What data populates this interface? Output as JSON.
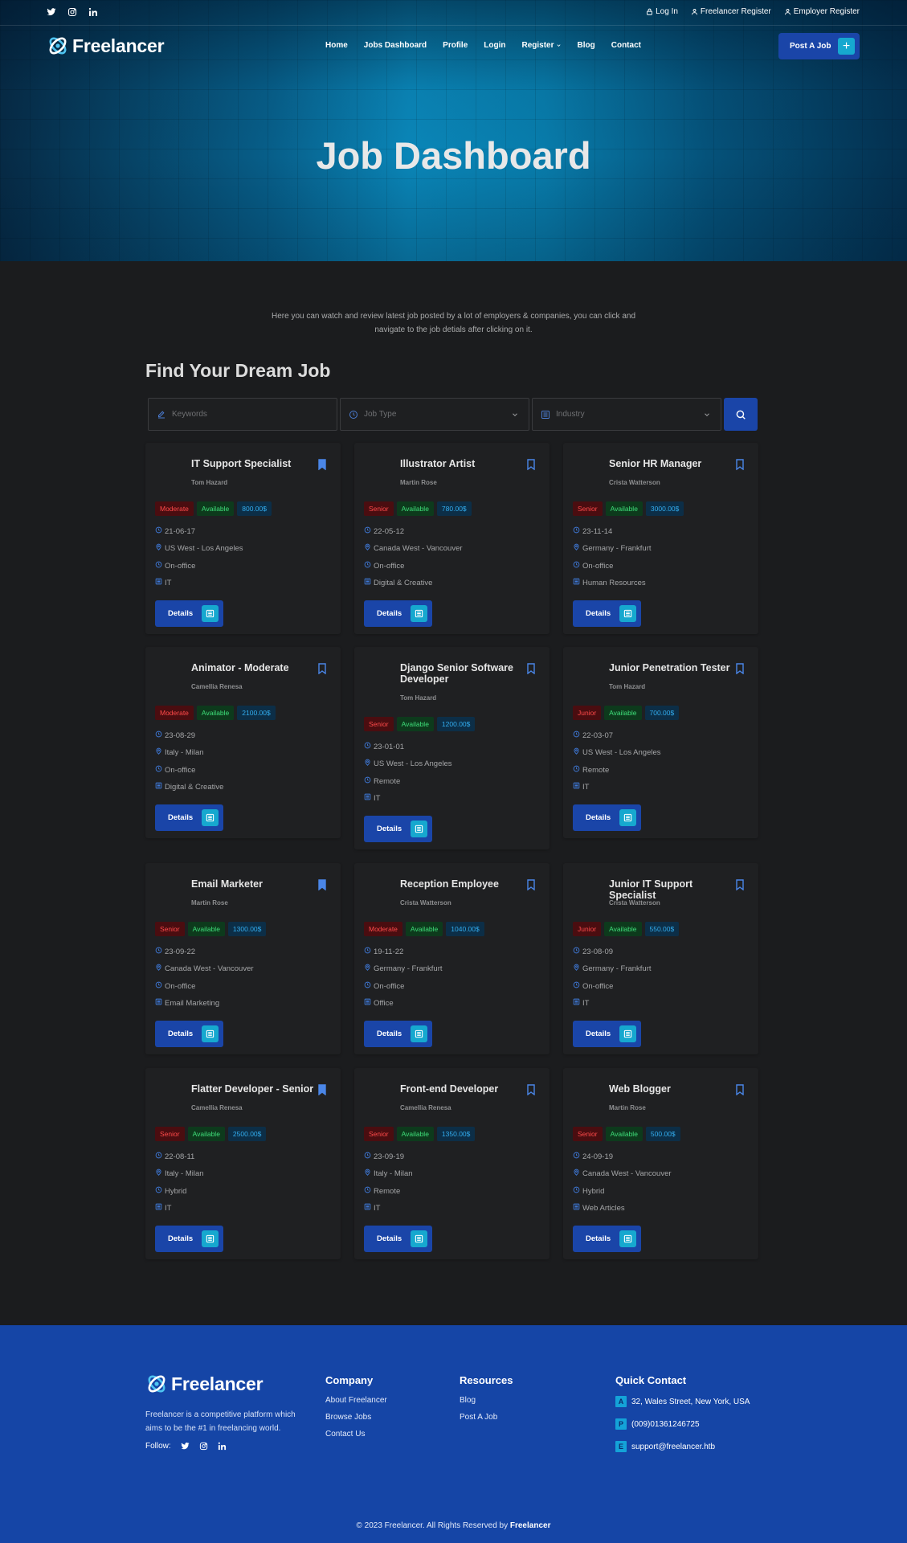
{
  "topbar": {
    "social": [
      "twitter-icon",
      "instagram-icon",
      "linkedin-icon"
    ],
    "links": [
      {
        "label": "Log In",
        "icon": "lock-icon"
      },
      {
        "label": "Freelancer Register",
        "icon": "user-icon"
      },
      {
        "label": "Employer Register",
        "icon": "user-icon"
      }
    ]
  },
  "header": {
    "logo": "Freelancer",
    "nav": [
      "Home",
      "Jobs Dashboard",
      "Profile",
      "Login",
      "Register",
      "Blog",
      "Contact"
    ],
    "post_job": "Post A Job"
  },
  "hero": {
    "title": "Job Dashboard"
  },
  "intro": "Here you can watch and review latest job posted by a lot of employers & companies, you can click and navigate to the job detials after clicking on it.",
  "find_title": "Find Your Dream Job",
  "search": {
    "keywords_placeholder": "Keywords",
    "job_type_placeholder": "Job Type",
    "industry_placeholder": "Industry"
  },
  "details_label": "Details",
  "jobs": [
    {
      "title": "IT Support Specialist",
      "author": "Tom Hazard",
      "level": "Moderate",
      "status": "Available",
      "price": "800.00$",
      "date": "21-06-17",
      "location": "US West - Los Angeles",
      "type": "On-office",
      "industry": "IT",
      "bookmarked": true
    },
    {
      "title": "Illustrator Artist",
      "author": "Martin Rose",
      "level": "Senior",
      "status": "Available",
      "price": "780.00$",
      "date": "22-05-12",
      "location": "Canada West - Vancouver",
      "type": "On-office",
      "industry": "Digital & Creative",
      "bookmarked": false
    },
    {
      "title": "Senior HR Manager",
      "author": "Crista Watterson",
      "level": "Senior",
      "status": "Available",
      "price": "3000.00$",
      "date": "23-11-14",
      "location": "Germany - Frankfurt",
      "type": "On-office",
      "industry": "Human Resources",
      "bookmarked": false
    },
    {
      "title": "Animator - Moderate",
      "author": "Camellia Renesa",
      "level": "Moderate",
      "status": "Available",
      "price": "2100.00$",
      "date": "23-08-29",
      "location": "Italy - Milan",
      "type": "On-office",
      "industry": "Digital & Creative",
      "bookmarked": false
    },
    {
      "title": "Django Senior Software Developer",
      "author": "Tom Hazard",
      "level": "Senior",
      "status": "Available",
      "price": "1200.00$",
      "date": "23-01-01",
      "location": "US West - Los Angeles",
      "type": "Remote",
      "industry": "IT",
      "bookmarked": false
    },
    {
      "title": "Junior Penetration Tester",
      "author": "Tom Hazard",
      "level": "Junior",
      "status": "Available",
      "price": "700.00$",
      "date": "22-03-07",
      "location": "US West - Los Angeles",
      "type": "Remote",
      "industry": "IT",
      "bookmarked": false
    },
    {
      "title": "Email Marketer",
      "author": "Martin Rose",
      "level": "Senior",
      "status": "Available",
      "price": "1300.00$",
      "date": "23-09-22",
      "location": "Canada West - Vancouver",
      "type": "On-office",
      "industry": "Email Marketing",
      "bookmarked": true
    },
    {
      "title": "Reception Employee",
      "author": "Crista Watterson",
      "level": "Moderate",
      "status": "Available",
      "price": "1040.00$",
      "date": "19-11-22",
      "location": "Germany - Frankfurt",
      "type": "On-office",
      "industry": "Office",
      "bookmarked": false
    },
    {
      "title": "Junior IT Support Specialist",
      "author": "Crista Watterson",
      "level": "Junior",
      "status": "Available",
      "price": "550.00$",
      "date": "23-08-09",
      "location": "Germany - Frankfurt",
      "type": "On-office",
      "industry": "IT",
      "bookmarked": false
    },
    {
      "title": "Flatter Developer - Senior",
      "author": "Camellia Renesa",
      "level": "Senior",
      "status": "Available",
      "price": "2500.00$",
      "date": "22-08-11",
      "location": "Italy - Milan",
      "type": "Hybrid",
      "industry": "IT",
      "bookmarked": true
    },
    {
      "title": "Front-end Developer",
      "author": "Camellia Renesa",
      "level": "Senior",
      "status": "Available",
      "price": "1350.00$",
      "date": "23-09-19",
      "location": "Italy - Milan",
      "type": "Remote",
      "industry": "IT",
      "bookmarked": false
    },
    {
      "title": "Web Blogger",
      "author": "Martin Rose",
      "level": "Senior",
      "status": "Available",
      "price": "500.00$",
      "date": "24-09-19",
      "location": "Canada West - Vancouver",
      "type": "Hybrid",
      "industry": "Web Articles",
      "bookmarked": false
    }
  ],
  "footer": {
    "logo": "Freelancer",
    "about": "Freelancer is a competitive platform which aims to be the #1 in freelancing world.",
    "follow": "Follow:",
    "company": {
      "heading": "Company",
      "links": [
        "About Freelancer",
        "Browse Jobs",
        "Contact Us"
      ]
    },
    "resources": {
      "heading": "Resources",
      "links": [
        "Blog",
        "Post A Job"
      ]
    },
    "contact": {
      "heading": "Quick Contact",
      "items": [
        {
          "icon": "A",
          "text": "32, Wales Street, New York, USA"
        },
        {
          "icon": "P",
          "text": "(009)01361246725"
        },
        {
          "icon": "E",
          "text": "support@freelancer.htb"
        }
      ]
    },
    "copyright": "© 2023 Freelancer. All Rights Reserved by",
    "copyright_brand": "Freelancer"
  },
  "colors": {
    "accent": "#1a45a8",
    "cyan": "#16a8cf",
    "footer": "#1545a6"
  }
}
